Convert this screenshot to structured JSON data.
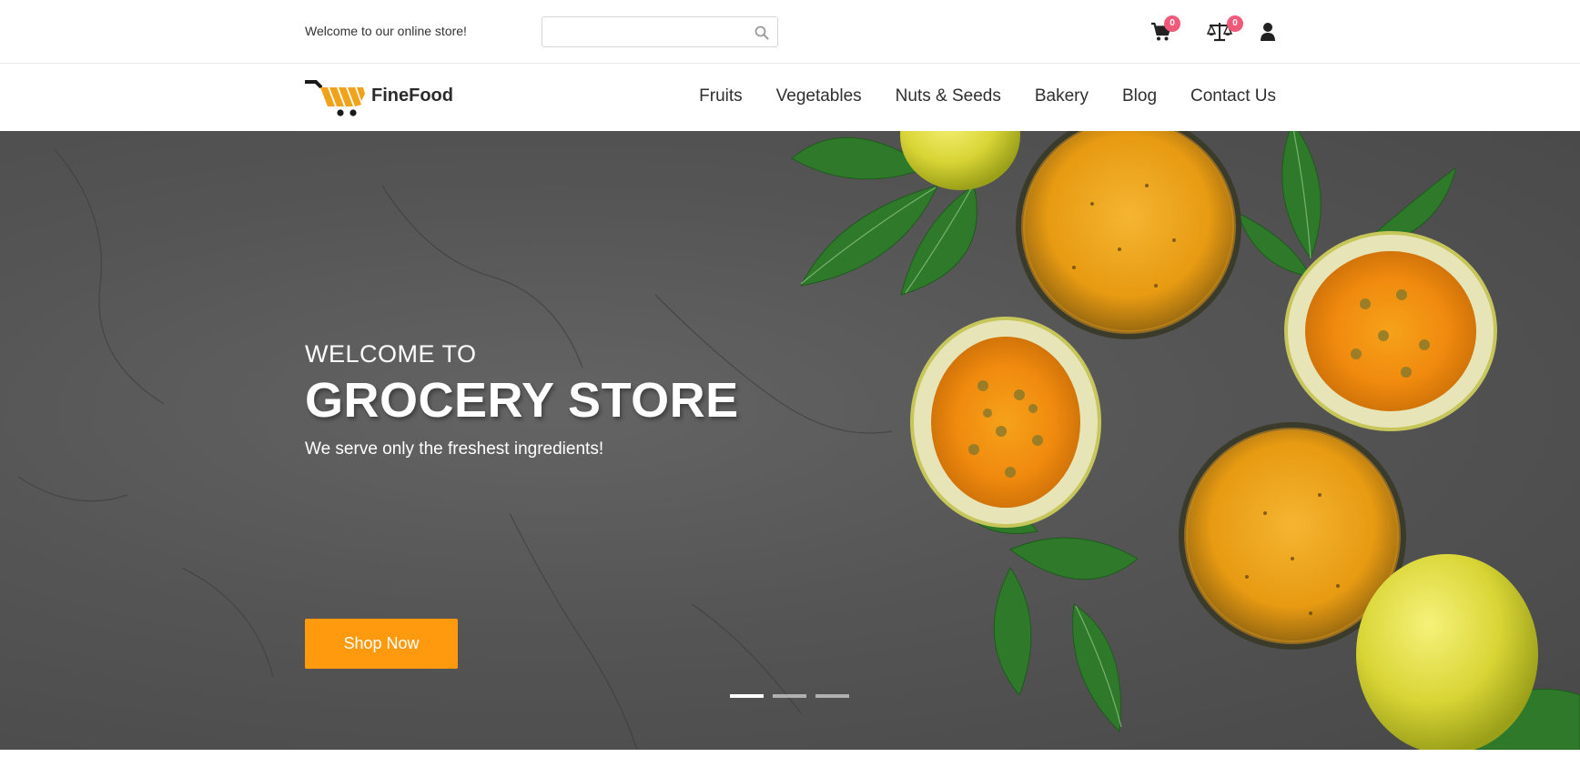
{
  "topbar": {
    "welcome": "Welcome to our online store!",
    "search_placeholder": "",
    "icons": [
      "search-icon",
      "cart-icon",
      "compare-icon",
      "user-icon"
    ],
    "cart_count": "0",
    "compare_count": "0"
  },
  "header": {
    "brand": "FineFood",
    "nav": [
      {
        "label": "Fruits"
      },
      {
        "label": "Vegetables"
      },
      {
        "label": "Nuts & Seeds"
      },
      {
        "label": "Bakery"
      },
      {
        "label": "Blog"
      },
      {
        "label": "Contact Us"
      }
    ]
  },
  "hero": {
    "kicker": "WELCOME TO",
    "headline": "GROCERY STORE",
    "subline": "We serve only the freshest ingredients!",
    "cta_label": "Shop Now",
    "slides_total": 3,
    "active_slide": 1
  },
  "colors": {
    "accent": "#ff9a0e",
    "badge": "#f05a78",
    "hero_bg": "#555555"
  }
}
